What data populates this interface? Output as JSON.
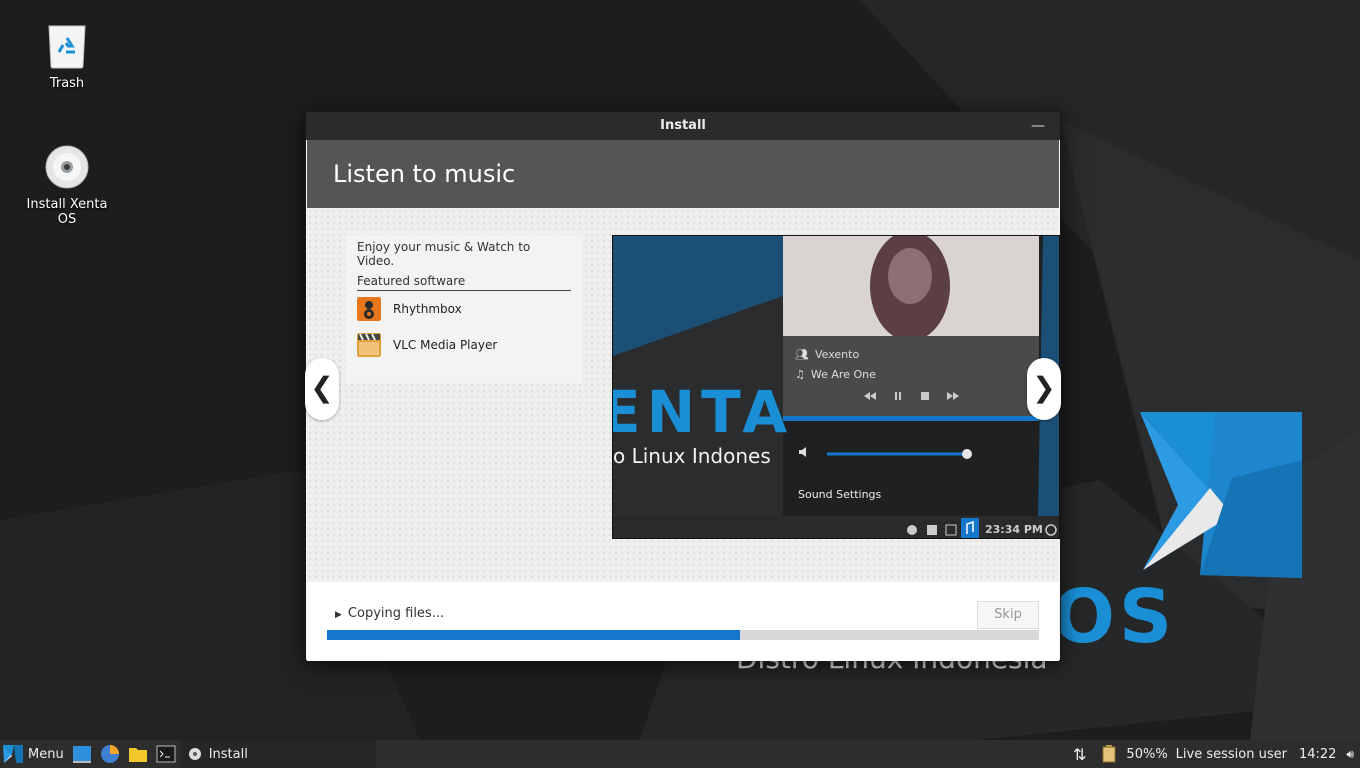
{
  "desktop": {
    "icons": [
      {
        "label": "Trash",
        "icon": "trash-icon"
      },
      {
        "label": "Install Xenta OS",
        "icon": "disc-icon"
      }
    ],
    "wallpaper": {
      "logo_title": "OS",
      "logo_subtitle": "Distro Linux Indonesia",
      "accent": "#1a8fd6"
    }
  },
  "window": {
    "title": "Install",
    "minimize_label": "—",
    "header": "Listen to music",
    "slide": {
      "description": "Enjoy your music & Watch to Video.",
      "featured_title": "Featured software",
      "apps": [
        {
          "name": "Rhythmbox",
          "icon": "rhythmbox-icon"
        },
        {
          "name": "VLC Media Player",
          "icon": "vlc-icon"
        }
      ],
      "screenshot": {
        "brand_text": "ENTA",
        "brand_subtext": "o Linux Indones",
        "artist": "Vexento",
        "track": "We Are One",
        "sound_settings": "Sound Settings",
        "clock": "23:34 PM"
      },
      "prev_label": "❮",
      "next_label": "❯"
    },
    "progress": {
      "label": "Copying files...",
      "fraction": 0.58,
      "skip_label": "Skip"
    }
  },
  "taskbar": {
    "menu_label": "Menu",
    "window_button": "Install",
    "battery": "50%%",
    "user": "Live session user",
    "time": "14:22"
  },
  "colors": {
    "accent": "#1577cb",
    "header_bg": "#555555",
    "titlebar_bg": "#2b2b2b",
    "taskbar_bg": "#2d2d2d"
  }
}
